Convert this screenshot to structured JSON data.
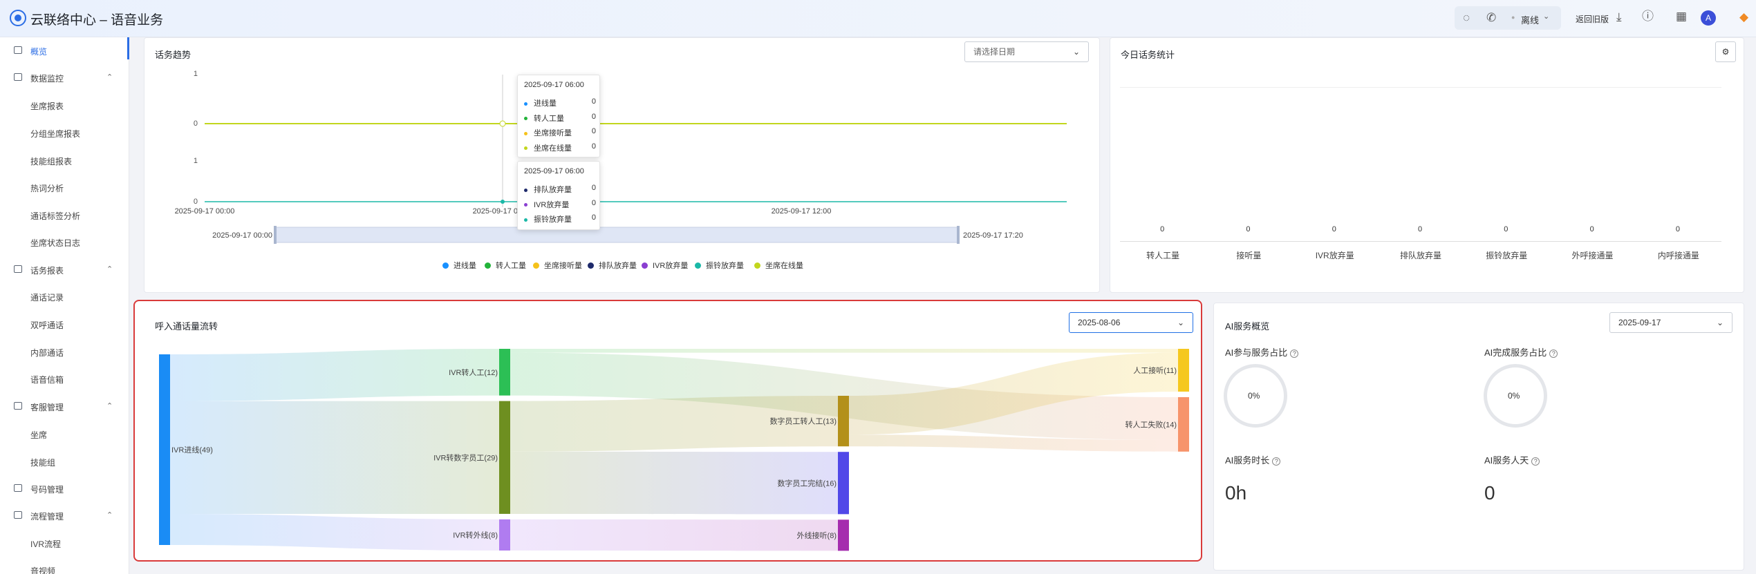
{
  "header": {
    "title": "云联络中心 – 语音业务",
    "status": "离线",
    "return_label": "返回旧版",
    "avatar": "A"
  },
  "sidebar": {
    "items": [
      {
        "label": "概览",
        "type": "item",
        "active": true
      },
      {
        "label": "数据监控",
        "type": "group"
      },
      {
        "label": "坐席报表",
        "type": "sub"
      },
      {
        "label": "分组坐席报表",
        "type": "sub"
      },
      {
        "label": "技能组报表",
        "type": "sub"
      },
      {
        "label": "热词分析",
        "type": "sub"
      },
      {
        "label": "通话标签分析",
        "type": "sub"
      },
      {
        "label": "坐席状态日志",
        "type": "sub"
      },
      {
        "label": "话务报表",
        "type": "group"
      },
      {
        "label": "通话记录",
        "type": "sub"
      },
      {
        "label": "双呼通话",
        "type": "sub"
      },
      {
        "label": "内部通话",
        "type": "sub"
      },
      {
        "label": "语音信箱",
        "type": "sub"
      },
      {
        "label": "客服管理",
        "type": "group"
      },
      {
        "label": "坐席",
        "type": "sub"
      },
      {
        "label": "技能组",
        "type": "sub"
      },
      {
        "label": "号码管理",
        "type": "item"
      },
      {
        "label": "流程管理",
        "type": "group"
      },
      {
        "label": "IVR流程",
        "type": "sub"
      },
      {
        "label": "音视频",
        "type": "sub"
      }
    ]
  },
  "trend": {
    "title": "话务趋势",
    "date_placeholder": "请选择日期",
    "upper_yticks": [
      "1",
      "0"
    ],
    "lower_yticks": [
      "1",
      "0"
    ],
    "xticks": [
      "2025-09-17 00:00",
      "2025-09-17 06:00",
      "2025-09-17 12:00"
    ],
    "range_start": "2025-09-17 00:00",
    "range_end": "2025-09-17 17:20",
    "tooltip_top": {
      "time": "2025-09-17 06:00",
      "rows": [
        {
          "label": "进线量",
          "value": "0",
          "color": "#1890ff"
        },
        {
          "label": "转人工量",
          "value": "0",
          "color": "#23b33a"
        },
        {
          "label": "坐席接听量",
          "value": "0",
          "color": "#f5c21b"
        },
        {
          "label": "坐席在线量",
          "value": "0",
          "color": "#c2d61d"
        }
      ]
    },
    "tooltip_bottom": {
      "time": "2025-09-17 06:00",
      "rows": [
        {
          "label": "排队放弃量",
          "value": "0",
          "color": "#1e2a6b"
        },
        {
          "label": "IVR放弃量",
          "value": "0",
          "color": "#8a3fd1"
        },
        {
          "label": "振铃放弃量",
          "value": "0",
          "color": "#1bb8a7"
        }
      ]
    },
    "legend": [
      {
        "label": "进线量",
        "color": "#1890ff"
      },
      {
        "label": "转人工量",
        "color": "#23b33a"
      },
      {
        "label": "坐席接听量",
        "color": "#f5c21b"
      },
      {
        "label": "排队放弃量",
        "color": "#1e2a6b"
      },
      {
        "label": "IVR放弃量",
        "color": "#8a3fd1"
      },
      {
        "label": "振铃放弃量",
        "color": "#1bb8a7"
      },
      {
        "label": "坐席在线量",
        "color": "#c2d61d"
      }
    ]
  },
  "today": {
    "title": "今日话务统计",
    "stats": [
      {
        "label": "转人工量",
        "value": "0"
      },
      {
        "label": "接听量",
        "value": "0"
      },
      {
        "label": "IVR放弃量",
        "value": "0"
      },
      {
        "label": "排队放弃量",
        "value": "0"
      },
      {
        "label": "振铃放弃量",
        "value": "0"
      },
      {
        "label": "外呼接通量",
        "value": "0"
      },
      {
        "label": "内呼接通量",
        "value": "0"
      }
    ]
  },
  "flow": {
    "title": "呼入通话量流转",
    "date": "2025-08-06",
    "nodes": [
      {
        "id": "in",
        "label": "IVR进线(49)",
        "color": "#1a8cf5"
      },
      {
        "id": "tr",
        "label": "IVR转人工(12)",
        "color": "#2cbf55"
      },
      {
        "id": "dg",
        "label": "IVR转数字员工(29)",
        "color": "#6e8f20"
      },
      {
        "id": "ex",
        "label": "IVR转外线(8)",
        "color": "#b07cf0"
      },
      {
        "id": "dt",
        "label": "数字员工转人工(13)",
        "color": "#b3901a"
      },
      {
        "id": "dd",
        "label": "数字员工完结(16)",
        "color": "#5148e8"
      },
      {
        "id": "ea",
        "label": "外线接听(8)",
        "color": "#a52dae"
      },
      {
        "id": "ha",
        "label": "人工接听(11)",
        "color": "#f5c81f"
      },
      {
        "id": "hf",
        "label": "转人工失败(14)",
        "color": "#f7946b"
      }
    ],
    "links": [
      {
        "s": "in",
        "t": "tr",
        "v": 12
      },
      {
        "s": "in",
        "t": "dg",
        "v": 29
      },
      {
        "s": "in",
        "t": "ex",
        "v": 8
      },
      {
        "s": "tr",
        "t": "ha",
        "v": 1
      },
      {
        "s": "tr",
        "t": "hf",
        "v": 11
      },
      {
        "s": "dg",
        "t": "dt",
        "v": 13
      },
      {
        "s": "dg",
        "t": "dd",
        "v": 16
      },
      {
        "s": "ex",
        "t": "ea",
        "v": 8
      },
      {
        "s": "dt",
        "t": "ha",
        "v": 10
      },
      {
        "s": "dt",
        "t": "hf",
        "v": 3
      }
    ]
  },
  "ai": {
    "title": "AI服务概览",
    "date": "2025-09-17",
    "part_label": "AI参与服务占比",
    "part_value": "0%",
    "done_label": "AI完成服务占比",
    "done_value": "0%",
    "dur_label": "AI服务时长",
    "dur_value": "0h",
    "days_label": "AI服务人天",
    "days_value": "0"
  }
}
